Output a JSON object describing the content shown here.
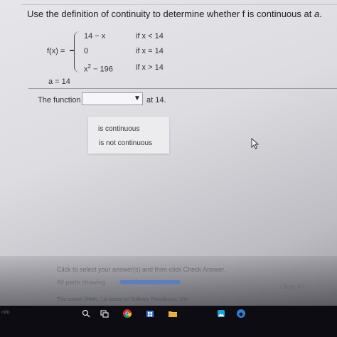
{
  "question": {
    "prefix": "Use the definition of continuity to determine whether f is continuous at ",
    "var": "a",
    "suffix": "."
  },
  "function_def": {
    "label": "f(x) =",
    "cases": [
      {
        "expr": "14 − x",
        "cond": "if x < 14"
      },
      {
        "expr": "0",
        "cond": "if x = 14"
      },
      {
        "expr_base": "x",
        "expr_sup": "2",
        "expr_rest": " − 196",
        "cond": "if x > 14"
      }
    ]
  },
  "a_value": "a = 14",
  "answer": {
    "label": "The function",
    "selected": "",
    "after": "at 14.",
    "options": [
      "is continuous",
      "is not continuous"
    ]
  },
  "bottom": {
    "instruction": "Click to select your answer(s) and then click Check Answer.",
    "progress_label": "All parts showing",
    "progress_fraction": 1.0,
    "clear_label": "Clear All",
    "footer_note": "This course (Math...) is based on Sullivan: Precalculus, 10e"
  },
  "taskbar": {
    "left_text": "ndo"
  },
  "colors": {
    "progress": "#5e7fbd",
    "background": "#e6e6ea"
  },
  "icons": [
    "cursor-arrow-icon",
    "dropdown-arrow-icon",
    "search-icon",
    "task-view-icon",
    "chrome-icon",
    "store-icon",
    "file-explorer-icon",
    "photos-icon",
    "edge-icon"
  ]
}
